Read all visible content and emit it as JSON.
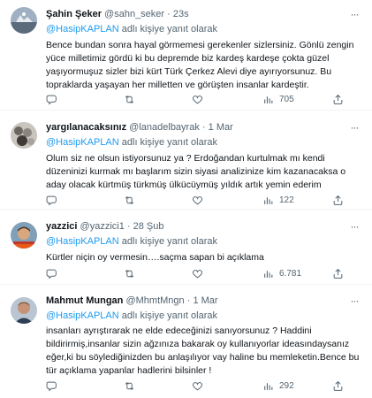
{
  "tweets": [
    {
      "name": "Şahin Şeker",
      "handle": "@sahn_seker",
      "time": "23s",
      "reply_prefix": "@HasipKAPLAN",
      "reply_suffix": "adlı kişiye yanıt olarak",
      "text": "Bence bundan sonra hayal görmemesi gerekenler sizlersiniz. Gönlü zengin yüce milletimiz gördü ki bu depremde biz kardeş kardeşe çokta güzel yaşıyormuşuz sizler bizi kürt Türk Çerkez Alevi diye ayırıyorsunuz. Bu topraklarda yaşayan her milletten ve görüşten insanlar kardeştir.",
      "stats_count": "705",
      "more_icon": "more-dots-icon"
    },
    {
      "name": "yargılanacaksınız",
      "handle": "@lanadelbayrak",
      "time": "1 Mar",
      "reply_prefix": "@HasipKAPLAN",
      "reply_suffix": "adlı kişiye yanıt olarak",
      "text": "Olum siz ne olsun istiyorsunuz ya ? Erdoğandan kurtulmak mı kendi düzeninizi kurmak mı başlarım sizin siyasi analizinize kim kazanacaksa o aday olacak kürtmüş türkmüş ülkücüymüş yıldık artık yemin ederim",
      "stats_count": "122"
    },
    {
      "name": "yazzici",
      "handle": "@yazzici1",
      "time": "28 Şub",
      "reply_prefix": "@HasipKAPLAN",
      "reply_suffix": "adlı kişiye yanıt olarak",
      "text": "Kürtler niçin oy vermesin….saçma sapan bi açıklama",
      "stats_count": "6.781"
    },
    {
      "name": "Mahmut Mungan",
      "handle": "@MhmtMngn",
      "time": "1 Mar",
      "reply_prefix": "@HasipKAPLAN",
      "reply_suffix": "adlı kişiye yanıt olarak",
      "text": "insanları ayrıştırarak ne elde edeceğinizi sanıyorsunuz ? Haddini bildirirmiş,insanlar sizin ağzınıza bakarak oy kullanıyorlar ideasındaysanız eğer,ki bu söylediğinizden bu anlaşılıyor vay haline bu memleketin.Bence bu tür açıklama yapanlar hadlerini bilsinler !",
      "stats_count": "292"
    }
  ],
  "icons": {
    "reply": "reply-icon",
    "retweet": "retweet-icon",
    "like": "heart-icon",
    "views": "views-chart-icon",
    "share": "share-icon"
  },
  "colors": {
    "text": "#0f1419",
    "secondary": "#536471",
    "link": "#1d9bf0",
    "divider": "#eff3f4"
  },
  "separator": "·"
}
